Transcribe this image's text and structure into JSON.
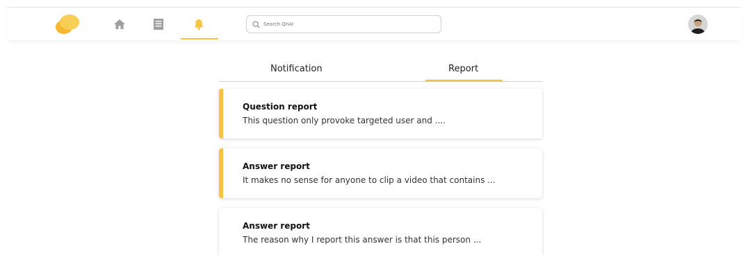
{
  "colors": {
    "accent": "#f5c542",
    "nav_icon": "#9e9e9e"
  },
  "header": {
    "logo_icon": "chat-bubbles-logo",
    "nav": [
      {
        "icon": "home-icon",
        "active": false
      },
      {
        "icon": "list-icon",
        "active": false
      },
      {
        "icon": "bell-icon",
        "active": true
      }
    ],
    "search": {
      "placeholder": "Search QnAI",
      "value": ""
    },
    "avatar_icon": "user-avatar"
  },
  "tabs": {
    "items": [
      {
        "label": "Notification",
        "active": false
      },
      {
        "label": "Report",
        "active": true
      }
    ]
  },
  "reports": [
    {
      "title": "Question report",
      "desc": "This question only provoke targeted user and ....",
      "unread": true
    },
    {
      "title": "Answer report",
      "desc": "It makes no sense for anyone to clip a video that contains ...",
      "unread": true
    },
    {
      "title": "Answer report",
      "desc": "The reason why I report this answer is that this person ...",
      "unread": false
    }
  ]
}
